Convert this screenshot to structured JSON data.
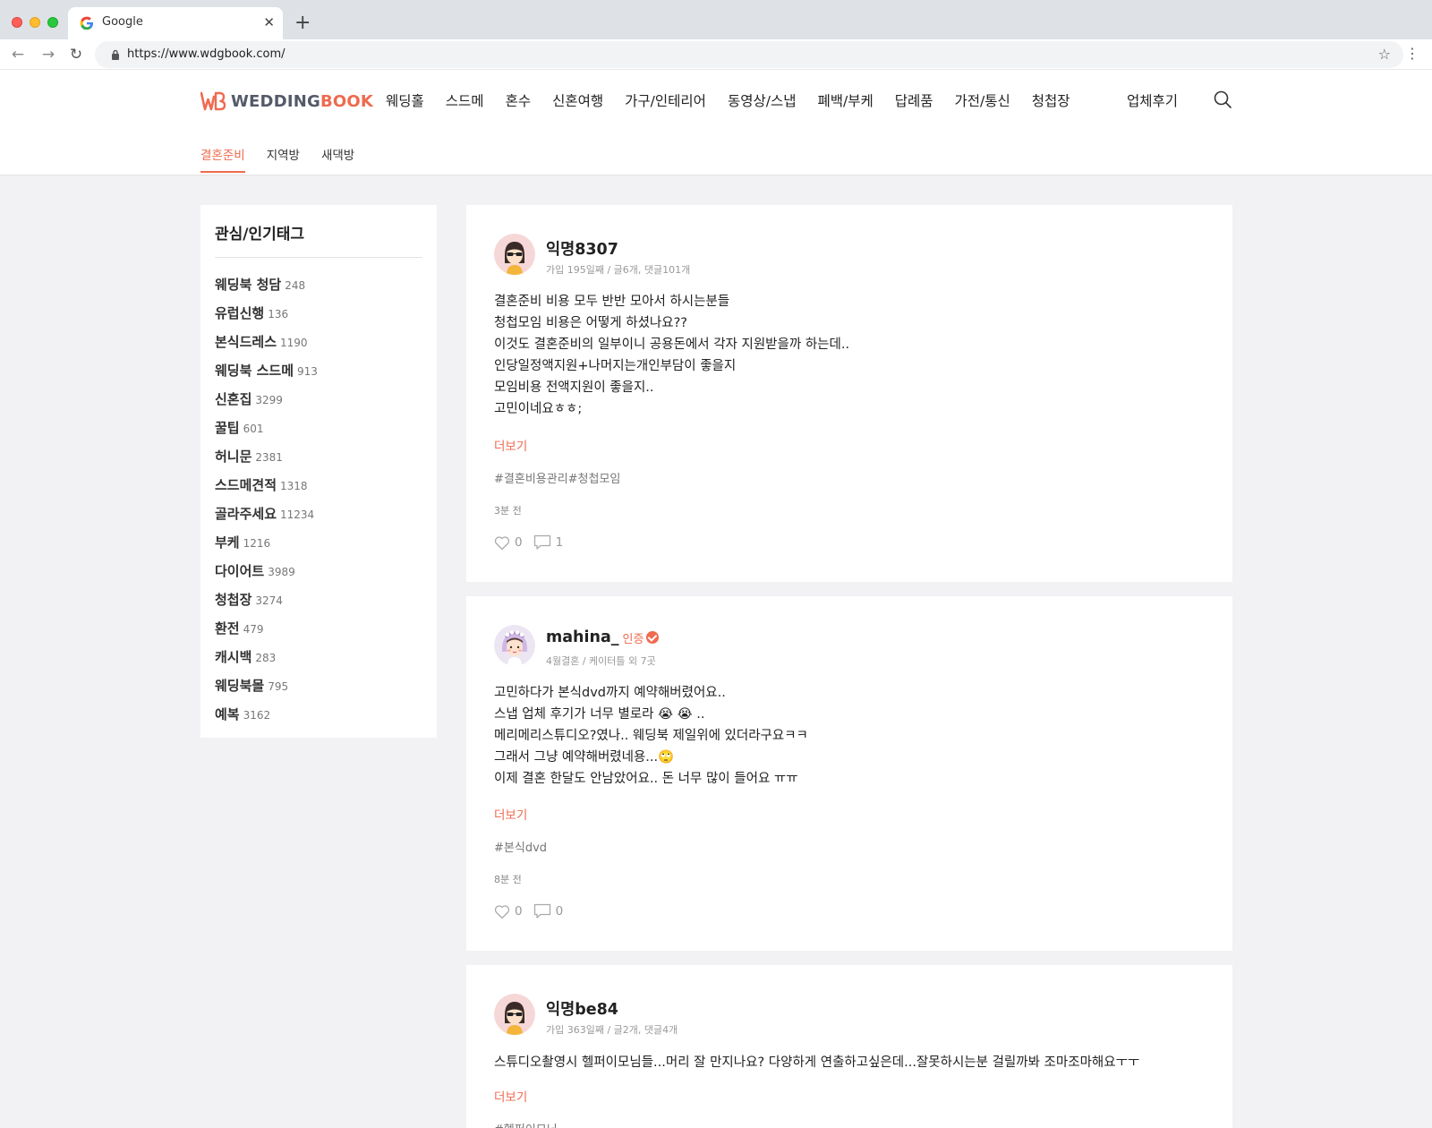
{
  "browser": {
    "tab_title": "Google",
    "url": "https://www.wdgbook.com/"
  },
  "site": {
    "logo_text_a": "WEDDING",
    "logo_text_b": "BOOK",
    "nav": [
      "웨딩홀",
      "스드메",
      "혼수",
      "신혼여행",
      "가구/인테리어",
      "동영상/스냅",
      "폐백/부케",
      "답례품",
      "가전/통신",
      "청첩장"
    ],
    "review": "업체후기",
    "sub_nav": [
      "결혼준비",
      "지역방",
      "새댁방"
    ]
  },
  "sidebar": {
    "title": "관심/인기태그",
    "tags": [
      {
        "name": "웨딩북 청담",
        "count": "248"
      },
      {
        "name": "유럽신행",
        "count": "136"
      },
      {
        "name": "본식드레스",
        "count": "1190"
      },
      {
        "name": "웨딩북 스드메",
        "count": "913"
      },
      {
        "name": "신혼집",
        "count": "3299"
      },
      {
        "name": "꿀팁",
        "count": "601"
      },
      {
        "name": "허니문",
        "count": "2381"
      },
      {
        "name": "스드메견적",
        "count": "1318"
      },
      {
        "name": "골라주세요",
        "count": "11234"
      },
      {
        "name": "부케",
        "count": "1216"
      },
      {
        "name": "다이어트",
        "count": "3989"
      },
      {
        "name": "청첩장",
        "count": "3274"
      },
      {
        "name": "환전",
        "count": "479"
      },
      {
        "name": "캐시백",
        "count": "283"
      },
      {
        "name": "웨딩북몰",
        "count": "795"
      },
      {
        "name": "예복",
        "count": "3162"
      }
    ]
  },
  "posts": [
    {
      "author": "익명8307",
      "meta": "가입 195일째 / 글6개, 댓글101개",
      "lines": [
        "결혼준비 비용 모두 반반 모아서 하시는분들",
        "청첩모임 비용은 어떻게 하셨나요??",
        "이것도 결혼준비의 일부이니 공용돈에서 각자 지원받을까 하는데..",
        "인당일정액지원+나머지는개인부담이 좋을지",
        "모임비용 전액지원이 좋을지..",
        "고민이네요ㅎㅎ;"
      ],
      "more": "더보기",
      "tags": "#결혼비용관리#청첩모임",
      "time": "3분 전",
      "likes": "0",
      "comments": "1"
    },
    {
      "author": "mahina_",
      "verified": "인증",
      "meta": "4월결혼 / 케이터틀 외 7곳",
      "lines": [
        "고민하다가 본식dvd까지 예약해버렸어요..",
        "스냅 업체 후기가 너무 별로라 😭 😭 ..",
        "메리메리스튜디오?였나.. 웨딩북 제일위에 있더라구요ㅋㅋ",
        "그래서 그냥 예약해버렸네용...🙄",
        "이제 결혼 한달도 안남았어요.. 돈 너무 많이 들어요 ㅠㅠ"
      ],
      "more": "더보기",
      "tags": "#본식dvd",
      "time": "8분 전",
      "likes": "0",
      "comments": "0"
    },
    {
      "author": "익명be84",
      "meta": "가입 363일째 / 글2개, 댓글4개",
      "lines": [
        "스튜디오촬영시 헬퍼이모님들...머리 잘 만지나요? 다양하게 연출하고싶은데...잘못하시는분 걸릴까봐 조마조마해요ㅜㅜ"
      ],
      "more": "더보기",
      "tags": "#헬퍼이모님"
    }
  ],
  "colors": {
    "accent": "#ef6a4f",
    "logo_gray": "#555a6a",
    "page_bg": "#f2f2f4"
  }
}
